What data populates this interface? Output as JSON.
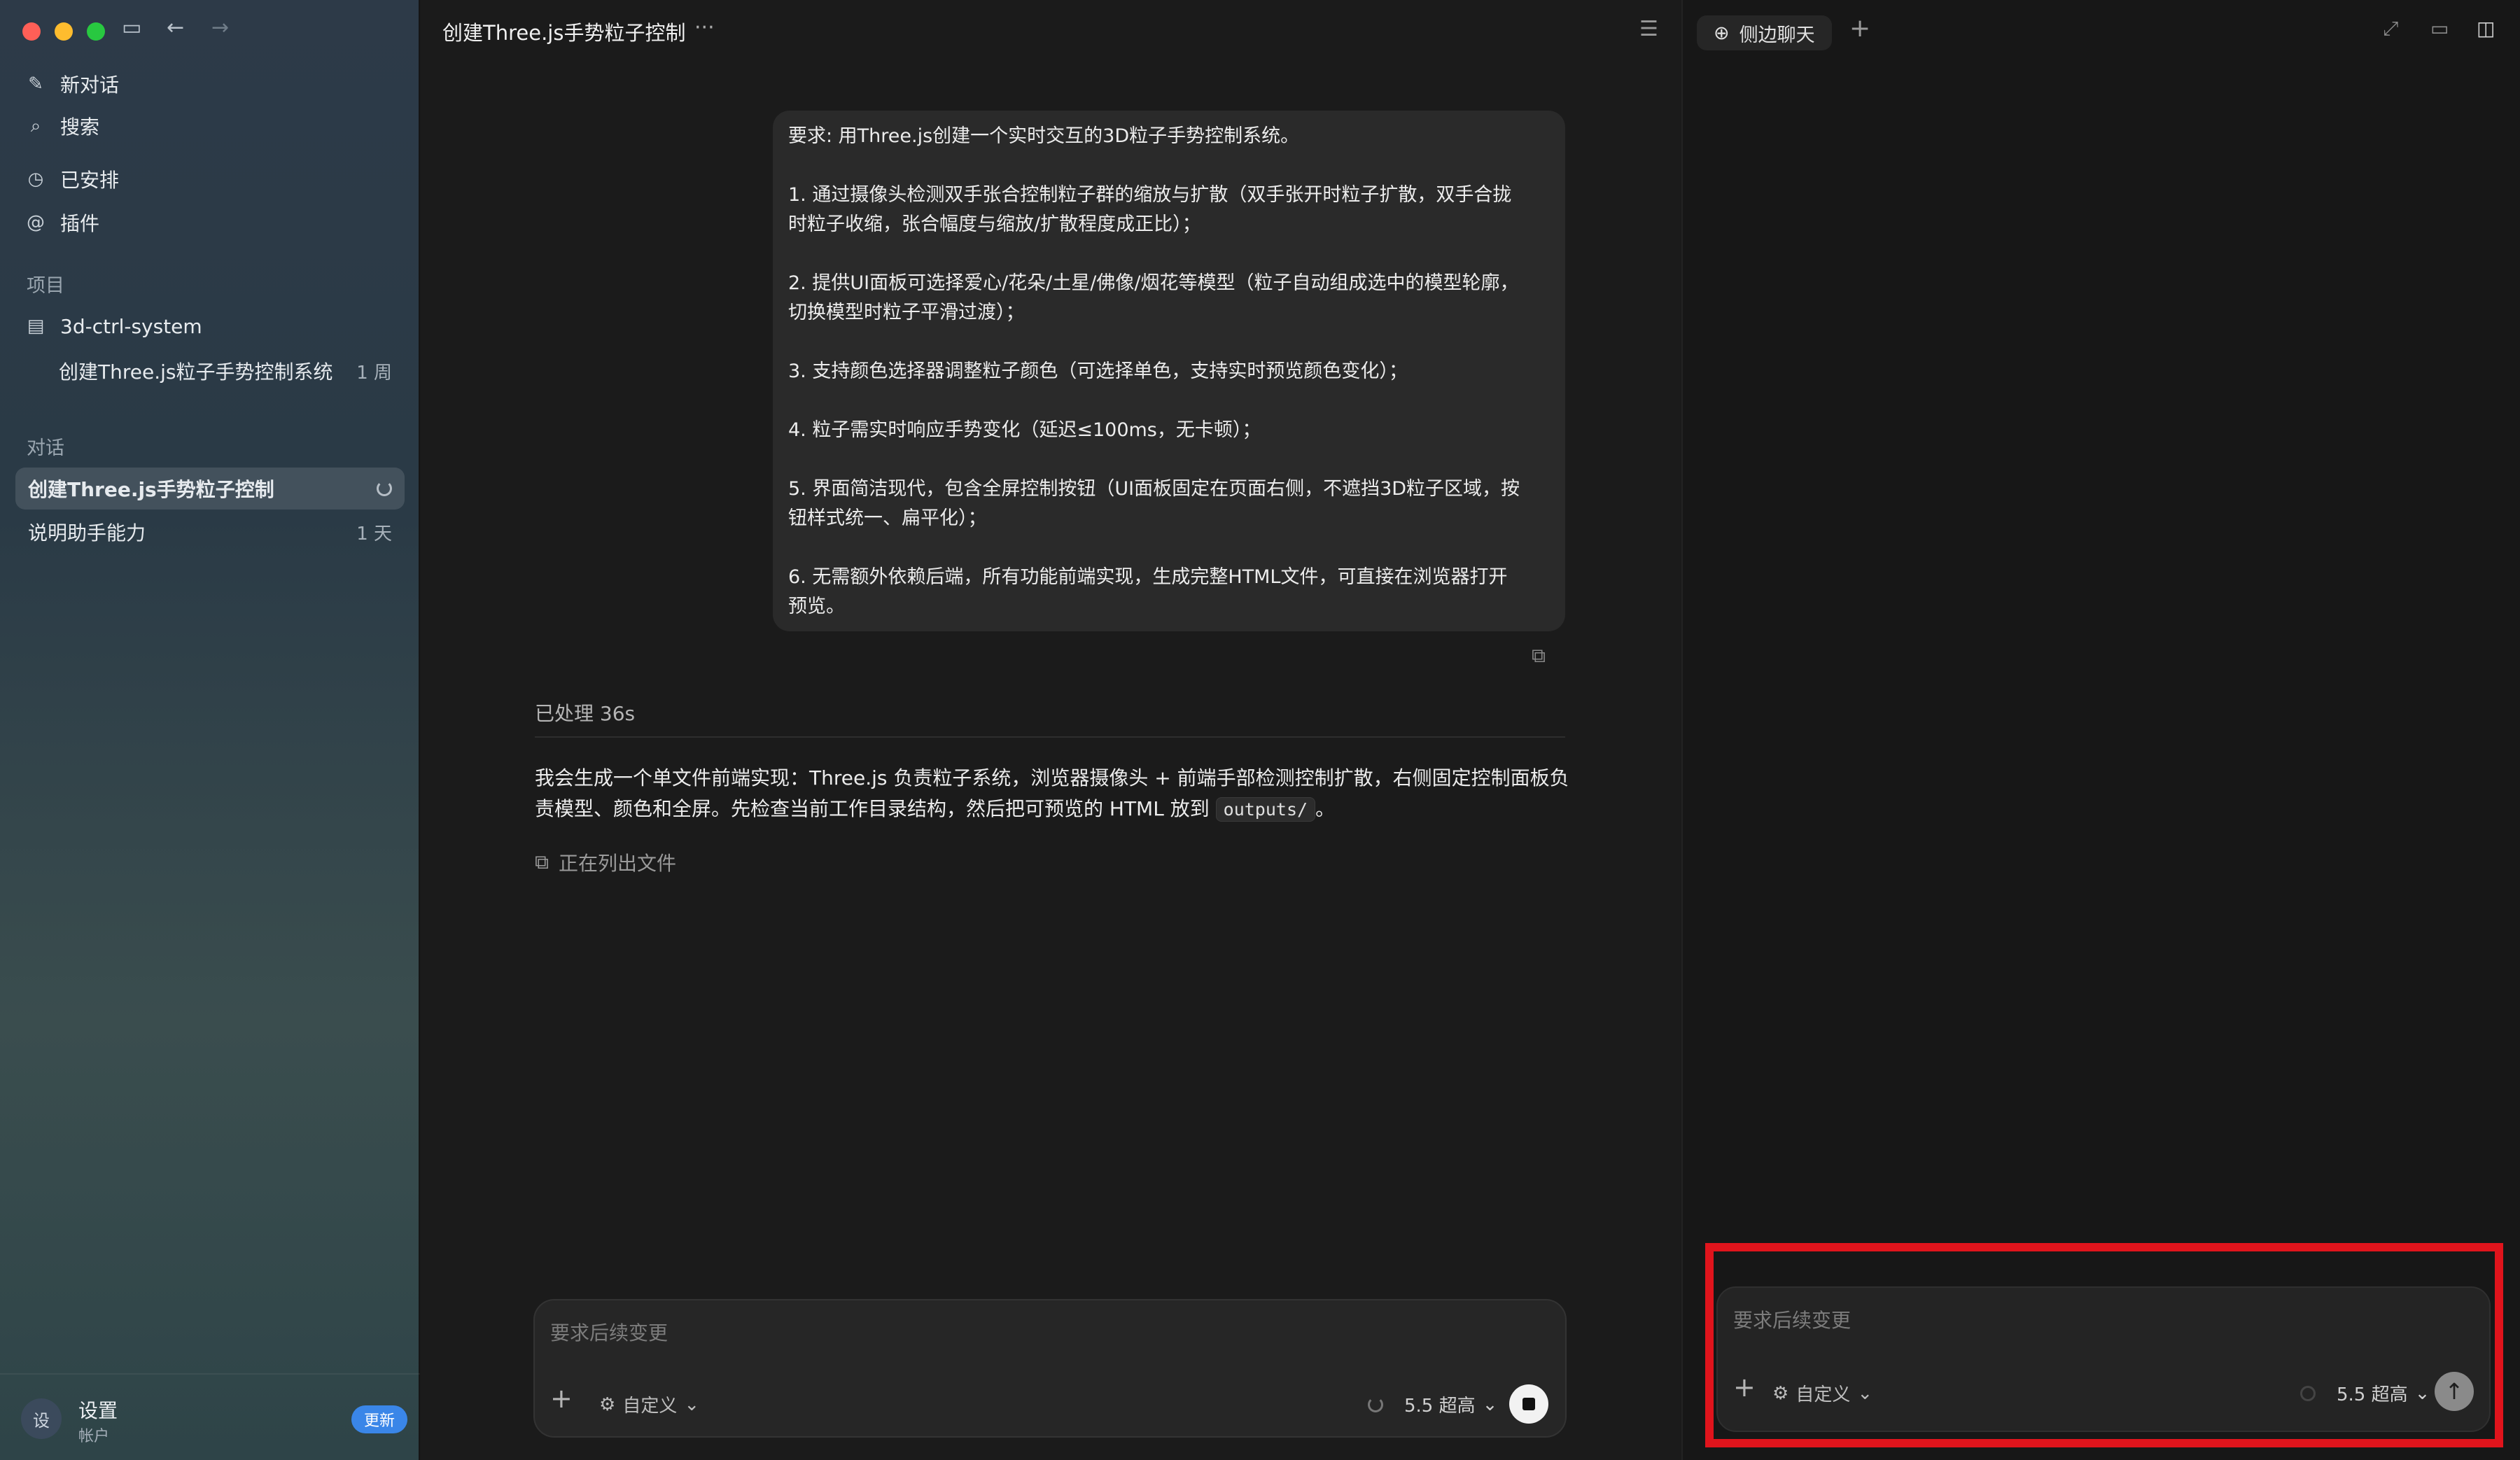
{
  "sidebar": {
    "nav": [
      {
        "label": "新对话",
        "icon": "edit-icon"
      },
      {
        "label": "搜索",
        "icon": "search-icon"
      },
      {
        "label": "已安排",
        "icon": "clock-icon"
      },
      {
        "label": "插件",
        "icon": "at-icon"
      }
    ],
    "projects_label": "项目",
    "project": {
      "name": "3d-ctrl-system",
      "icon": "folder-icon"
    },
    "project_chat": {
      "title": "创建Three.js粒子手势控制系统",
      "age": "1 周"
    },
    "chats_label": "对话",
    "chats": [
      {
        "title": "创建Three.js手势粒子控制",
        "age": ""
      },
      {
        "title": "说明助手能力",
        "age": "1 天"
      }
    ],
    "account": {
      "avatar": "设",
      "name": "设置",
      "sub": "帐户",
      "badge": "更新"
    }
  },
  "main": {
    "title": "创建Three.js手势粒子控制",
    "user_message": [
      "要求: 用Three.js创建一个实时交互的3D粒子手势控制系统。",
      "",
      "1. 通过摄像头检测双手张合控制粒子群的缩放与扩散（双手张开时粒子扩散，双手合拢",
      "时粒子收缩，张合幅度与缩放/扩散程度成正比）；",
      "",
      "2. 提供UI面板可选择爱心/花朵/土星/佛像/烟花等模型（粒子自动组成选中的模型轮廓，",
      "切换模型时粒子平滑过渡）；",
      "",
      "3. 支持颜色选择器调整粒子颜色（可选择单色，支持实时预览颜色变化）；",
      "",
      "4. 粒子需实时响应手势变化（延迟≤100ms，无卡顿）；",
      "",
      "5. 界面简洁现代，包含全屏控制按钮（UI面板固定在页面右侧，不遮挡3D粒子区域，按",
      "钮样式统一、扁平化）；",
      "",
      "6. 无需额外依赖后端，所有功能前端实现，生成完整HTML文件，可直接在浏览器打开",
      "预览。"
    ],
    "processed": "已处理 36s",
    "answer_line1": "我会生成一个单文件前端实现：Three.js 负责粒子系统，浏览器摄像头 + 前端手部检测控制扩散，右侧固定控制面板负",
    "answer_line2_pre": "责模型、颜色和全屏。先检查当前工作目录结构，然后把可预览的 HTML 放到",
    "answer_code": "outputs/",
    "answer_line2_post": "。",
    "status": "正在列出文件",
    "composer": {
      "placeholder": "要求后续变更",
      "mode": "自定义",
      "model": "5.5 超高"
    }
  },
  "right_panel": {
    "tab_label": "侧边聊天",
    "composer": {
      "placeholder": "要求后续变更",
      "mode": "自定义",
      "model": "5.5 超高"
    }
  },
  "colors": {
    "highlight": "#e0141c",
    "badge": "#3a86e8"
  }
}
